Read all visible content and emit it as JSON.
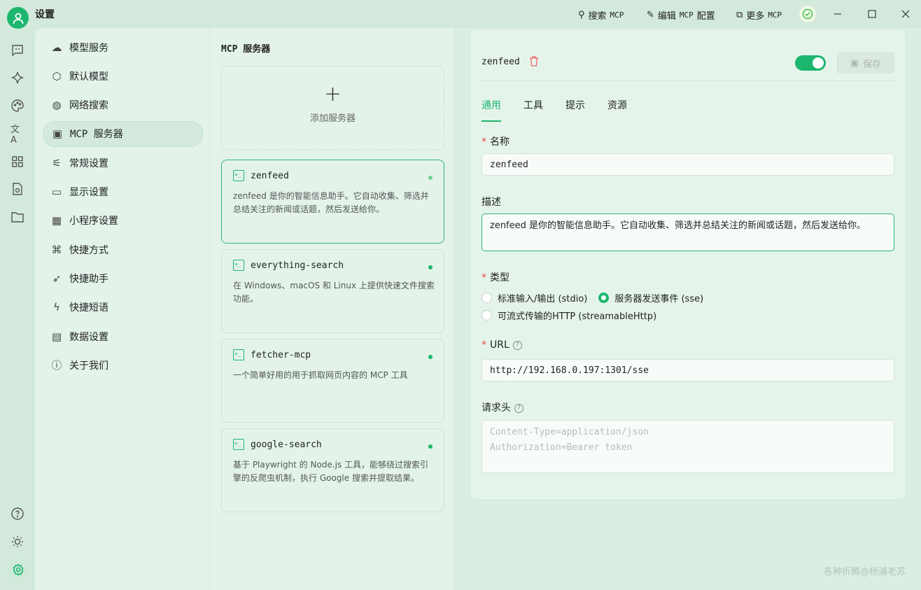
{
  "app": {
    "title": "设置"
  },
  "toolbar": {
    "search": "搜索",
    "search_mcp": "MCP",
    "edit": "编辑",
    "edit_mcp": "MCP",
    "edit_cfg": "配置",
    "more": "更多",
    "more_mcp": "MCP"
  },
  "nav": {
    "items": [
      {
        "label": "模型服务",
        "icon": "cloud-icon"
      },
      {
        "label": "默认模型",
        "icon": "cube-icon"
      },
      {
        "label": "网络搜索",
        "icon": "globe-icon"
      },
      {
        "label": "MCP 服务器",
        "icon": "terminal-icon",
        "active": true
      },
      {
        "label": "常规设置",
        "icon": "settings-sliders-icon"
      },
      {
        "label": "显示设置",
        "icon": "monitor-icon"
      },
      {
        "label": "小程序设置",
        "icon": "grid-icon"
      },
      {
        "label": "快捷方式",
        "icon": "command-icon"
      },
      {
        "label": "快捷助手",
        "icon": "rocket-icon"
      },
      {
        "label": "快捷短语",
        "icon": "zap-icon"
      },
      {
        "label": "数据设置",
        "icon": "drive-icon"
      },
      {
        "label": "关于我们",
        "icon": "info-icon"
      }
    ]
  },
  "mid": {
    "title": "MCP 服务器",
    "add": "添加服务器",
    "servers": [
      {
        "name": "zenfeed",
        "desc": "zenfeed 是你的智能信息助手。它自动收集、筛选并总结关注的新闻或话题，然后发送给你。",
        "active": true
      },
      {
        "name": "everything-search",
        "desc": "在 Windows、macOS 和 Linux 上提供快速文件搜索功能。"
      },
      {
        "name": "fetcher-mcp",
        "desc": "一个简单好用的用于抓取网页内容的 MCP 工具"
      },
      {
        "name": "google-search",
        "desc": "基于 Playwright 的 Node.js 工具，能够绕过搜索引擎的反爬虫机制，执行 Google 搜索并提取结果。"
      }
    ]
  },
  "detail": {
    "name": "zenfeed",
    "enabled": true,
    "save": "保存",
    "tabs": [
      "通用",
      "工具",
      "提示",
      "资源"
    ],
    "name_label": "名称",
    "name_value": "zenfeed",
    "desc_label": "描述",
    "desc_value": "zenfeed 是你的智能信息助手。它自动收集、筛选并总结关注的新闻或话题，然后发送给你。",
    "type_label": "类型",
    "types": [
      "标准输入/输出 (stdio)",
      "服务器发送事件 (sse)",
      "可流式传输的HTTP (streamableHttp)"
    ],
    "url_label": "URL",
    "url_value": "http://192.168.0.197:1301/sse",
    "headers_label": "请求头",
    "headers_placeholder": "Content-Type=application/json\nAuthorization=Bearer token"
  },
  "watermark": "各种折腾@杨浦老苏",
  "colors": {
    "accent": "#1db66f",
    "danger": "#e5484d"
  }
}
